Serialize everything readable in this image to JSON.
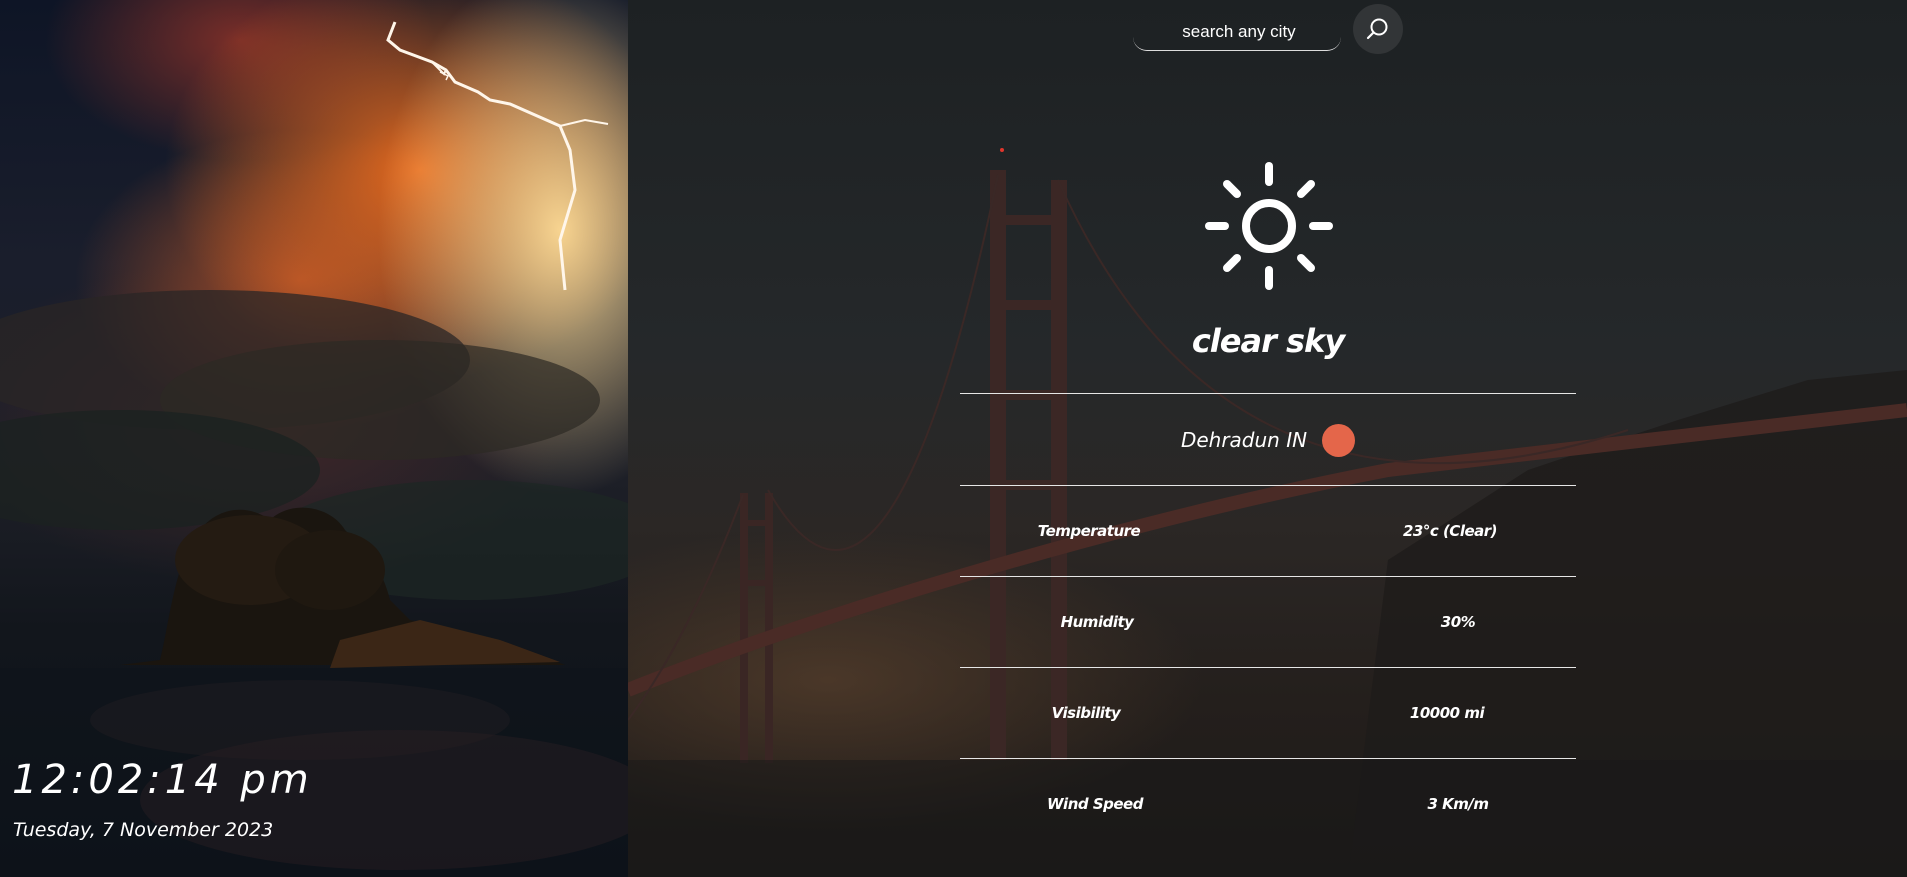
{
  "clock": {
    "time": "12:02:14 pm",
    "date": "Tuesday, 7 November 2023"
  },
  "search": {
    "placeholder": "search any city",
    "icon": "search-icon"
  },
  "weather": {
    "icon": "sun-icon",
    "description": "clear sky",
    "location": "Dehradun IN",
    "flag_color": "#e4664a"
  },
  "stats": [
    {
      "label": "Temperature",
      "value": "23°c (Clear)"
    },
    {
      "label": "Humidity",
      "value": "30%"
    },
    {
      "label": "Visibility",
      "value": "10000 mi"
    },
    {
      "label": "Wind Speed",
      "value": "3 Km/m"
    }
  ],
  "colors": {
    "text": "#ffffff",
    "panel_dark": "#25282a",
    "accent": "#e4664a",
    "lightning": "#fff7ee"
  }
}
